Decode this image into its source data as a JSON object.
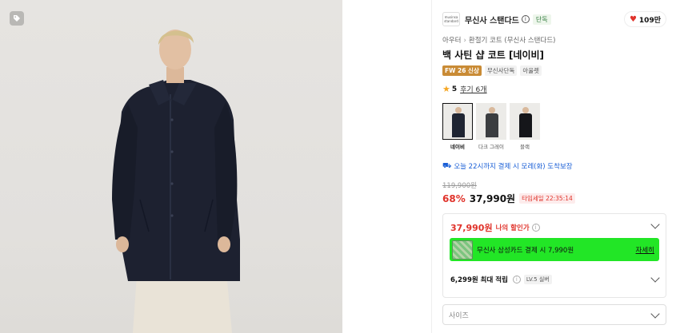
{
  "brand": {
    "logo_text": "musinsa standard",
    "name": "무신사 스탠다드",
    "exclusive_badge": "단독",
    "likes": "109만"
  },
  "breadcrumb": [
    "아우터",
    "환절기 코트 (무신사 스탠다드)"
  ],
  "product": {
    "title": "백 사틴 샵 코트 [네이비]",
    "badges": [
      "FW 26 신상",
      "무신사단독",
      "아울렛"
    ],
    "rating": "5",
    "reviews": "후기 6개"
  },
  "colors": [
    {
      "label": "네이비",
      "selected": true,
      "color": "#1f2533"
    },
    {
      "label": "다크 그레이",
      "selected": false,
      "color": "#3b3d40"
    },
    {
      "label": "블랙",
      "selected": false,
      "color": "#15161a"
    }
  ],
  "delivery": "오늘 22시까지 결제 시 모레(화) 도착보장",
  "pricing": {
    "original": "119,900원",
    "discount": "68%",
    "price": "37,990원",
    "timesale": "타임세일 22:35:14"
  },
  "benefits": {
    "my_price": "37,990원",
    "my_price_label": "나의 할인가",
    "card_promo": "무신사 삼성카드 결제 시 7,990원",
    "card_detail": "자세히",
    "points": "6,299원 최대 적립",
    "level": "LV.5 실버"
  },
  "size_select": {
    "placeholder": "사이즈"
  },
  "accent_colors": {
    "sale_red": "#e0332b",
    "promo_green": "#22e626",
    "delivery_blue": "#1a5fd6"
  }
}
